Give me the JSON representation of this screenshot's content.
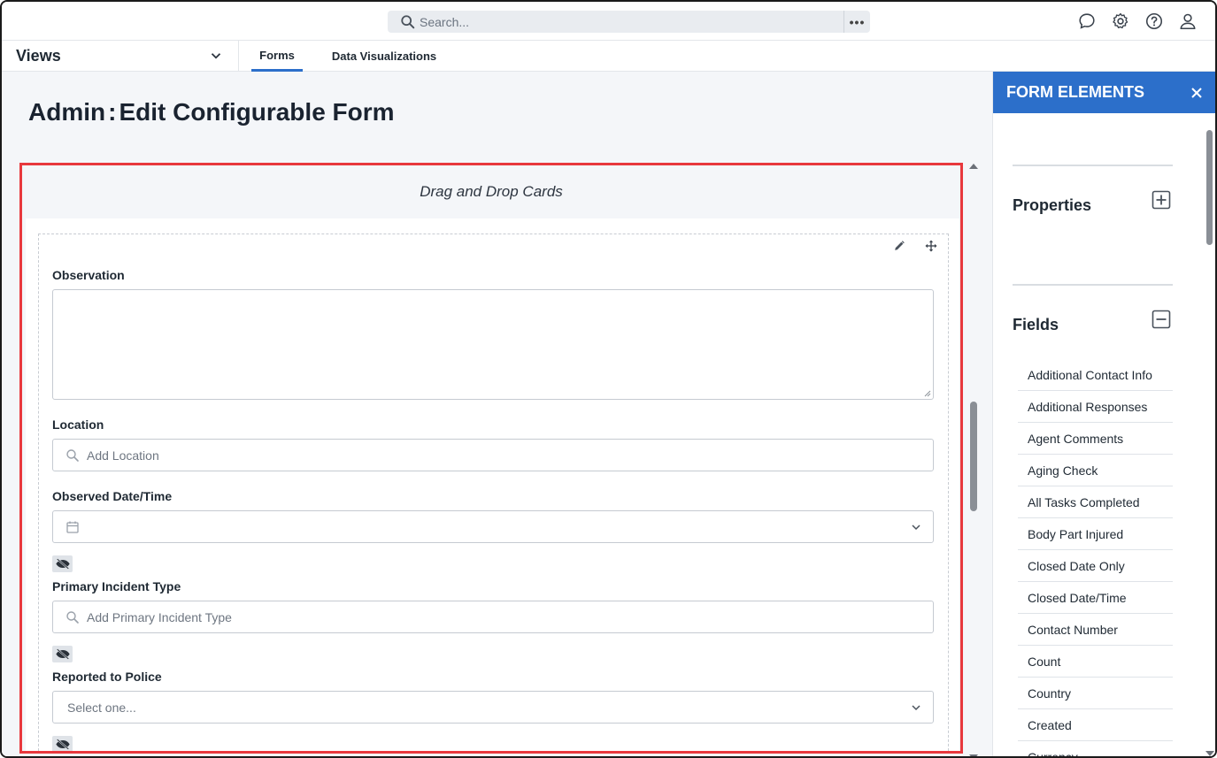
{
  "topbar": {
    "search_placeholder": "Search...",
    "more_label": "•••",
    "icons": [
      "chat-icon",
      "gear-icon",
      "help-icon",
      "user-icon"
    ]
  },
  "views": {
    "label": "Views",
    "tabs": [
      {
        "label": "Forms",
        "active": true
      },
      {
        "label": "Data Visualizations",
        "active": false
      }
    ]
  },
  "page": {
    "title_prefix": "Admin",
    "title_sep": ":",
    "title_main": "Edit Configurable Form"
  },
  "canvas": {
    "header": "Drag and Drop Cards",
    "fields": {
      "observation_label": "Observation",
      "location_label": "Location",
      "location_placeholder": "Add Location",
      "observed_label": "Observed Date/Time",
      "primary_label": "Primary Incident Type",
      "primary_placeholder": "Add Primary Incident Type",
      "police_label": "Reported to Police",
      "police_placeholder": "Select one..."
    }
  },
  "panel": {
    "title": "FORM ELEMENTS",
    "properties_title": "Properties",
    "fields_title": "Fields",
    "field_items": [
      "Additional Contact Info",
      "Additional Responses",
      "Agent Comments",
      "Aging Check",
      "All Tasks Completed",
      "Body Part Injured",
      "Closed Date Only",
      "Closed Date/Time",
      "Contact Number",
      "Count",
      "Country",
      "Created",
      "Currency"
    ]
  },
  "colors": {
    "accent": "#2c6fca",
    "highlight_border": "#e8383d"
  }
}
